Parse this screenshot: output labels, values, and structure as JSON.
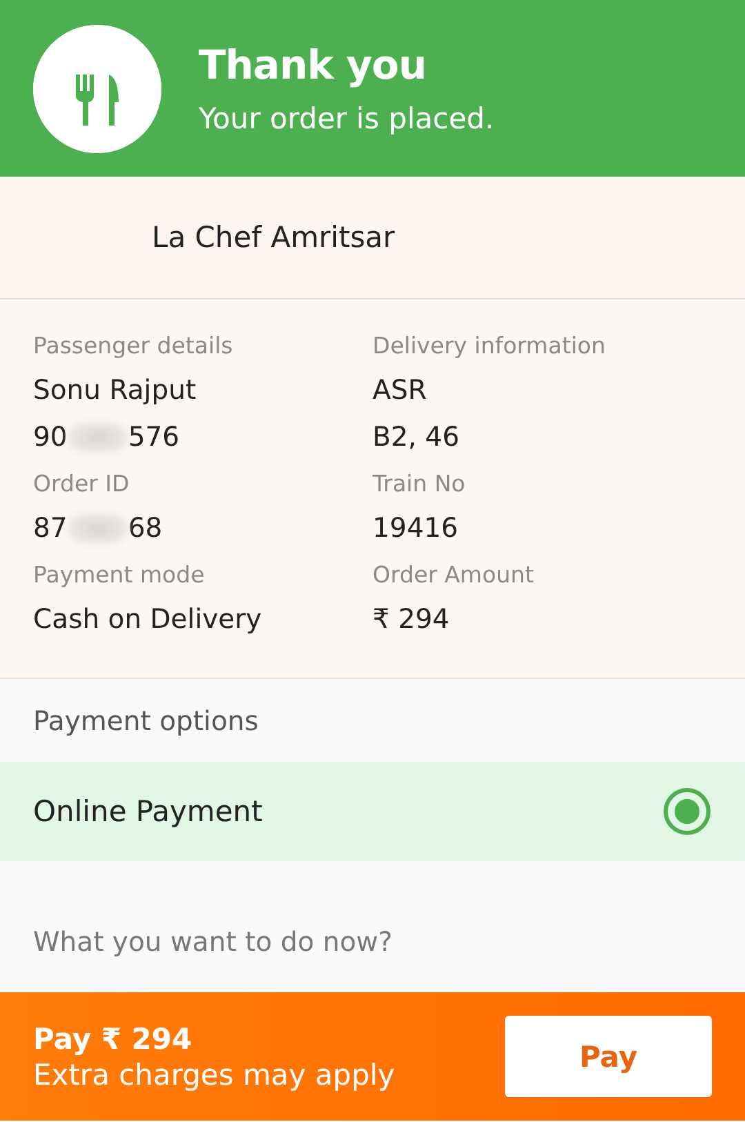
{
  "header": {
    "title": "Thank you",
    "subtitle": "Your order is placed."
  },
  "restaurant": {
    "name": "La Chef Amritsar"
  },
  "details": [
    {
      "label": "Passenger details",
      "values": [
        {
          "parts": [
            "Sonu Rajput"
          ]
        },
        {
          "parts": [
            "90",
            "576"
          ]
        }
      ]
    },
    {
      "label": "Delivery information",
      "values": [
        {
          "parts": [
            "ASR"
          ]
        },
        {
          "parts": [
            "B2, 46"
          ]
        }
      ]
    },
    {
      "label": "Order ID",
      "values": [
        {
          "parts": [
            "87",
            "68"
          ]
        }
      ]
    },
    {
      "label": "Train No",
      "values": [
        {
          "parts": [
            "19416"
          ]
        }
      ]
    },
    {
      "label": "Payment mode",
      "values": [
        {
          "parts": [
            "Cash on Delivery"
          ]
        }
      ]
    },
    {
      "label": "Order Amount",
      "values": [
        {
          "parts": [
            "₹ 294"
          ]
        }
      ]
    }
  ],
  "payment_options": {
    "title": "Payment options",
    "options": [
      {
        "label": "Online Payment",
        "selected": true
      }
    ]
  },
  "prompt": "What you want to do now?",
  "footer": {
    "amount": "Pay ₹ 294",
    "note": "Extra charges may apply",
    "button": "Pay"
  }
}
